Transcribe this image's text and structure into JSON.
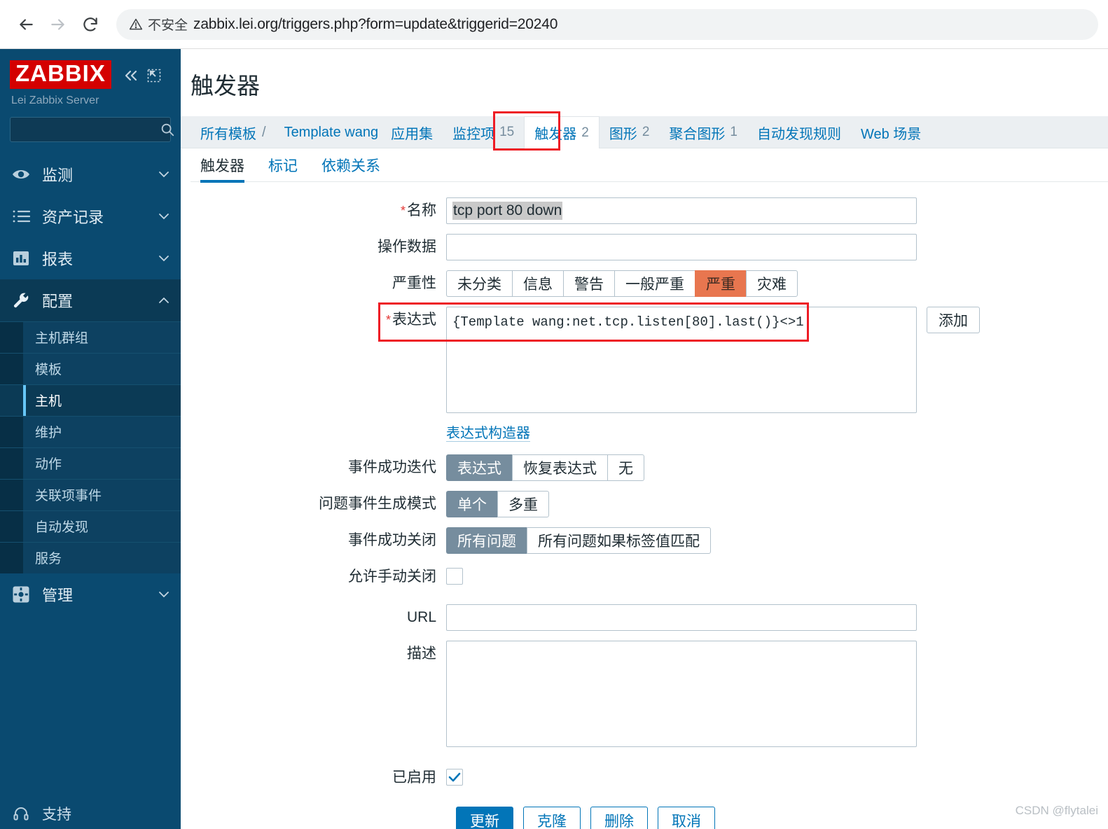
{
  "browser": {
    "back_icon": "back-arrow-icon",
    "forward_icon": "forward-arrow-icon",
    "reload_icon": "reload-icon",
    "security_label": "不安全",
    "security_icon": "warning-triangle-icon",
    "url": "zabbix.lei.org/triggers.php?form=update&triggerid=20240"
  },
  "sidebar": {
    "logo": "ZABBIX",
    "collapse_icon": "double-chevron-left-icon",
    "compact_icon": "compact-view-icon",
    "server_name": "Lei Zabbix Server",
    "search_placeholder": "",
    "search_value": "",
    "search_icon": "search-icon",
    "nav": [
      {
        "label": "监测",
        "icon": "eye-icon",
        "arrow": "chevron-down-icon",
        "active": false
      },
      {
        "label": "资产记录",
        "icon": "list-icon",
        "arrow": "chevron-down-icon",
        "active": false
      },
      {
        "label": "报表",
        "icon": "bar-chart-icon",
        "arrow": "chevron-down-icon",
        "active": false
      },
      {
        "label": "配置",
        "icon": "wrench-icon",
        "arrow": "chevron-up-icon",
        "active": true
      }
    ],
    "subnav": [
      {
        "label": "主机群组",
        "selected": false
      },
      {
        "label": "模板",
        "selected": false
      },
      {
        "label": "主机",
        "selected": true
      },
      {
        "label": "维护",
        "selected": false
      },
      {
        "label": "动作",
        "selected": false
      },
      {
        "label": "关联项事件",
        "selected": false
      },
      {
        "label": "自动发现",
        "selected": false
      },
      {
        "label": "服务",
        "selected": false
      }
    ],
    "admin": {
      "label": "管理",
      "icon": "gear-icon",
      "arrow": "chevron-down-icon"
    },
    "support": {
      "label": "支持",
      "icon": "headset-icon"
    }
  },
  "main": {
    "page_title": "触发器",
    "tabs": [
      {
        "label": "所有模板",
        "count": "",
        "kind": "crumb-link",
        "active": false
      },
      {
        "label": "Template wang",
        "count": "",
        "kind": "crumb-link",
        "active": false
      },
      {
        "label": "应用集",
        "count": "",
        "kind": "tab",
        "active": false
      },
      {
        "label": "监控项",
        "count": "15",
        "kind": "tab",
        "active": false
      },
      {
        "label": "触发器",
        "count": "2",
        "kind": "tab",
        "active": true
      },
      {
        "label": "图形",
        "count": "2",
        "kind": "tab",
        "active": false
      },
      {
        "label": "聚合图形",
        "count": "1",
        "kind": "tab",
        "active": false
      },
      {
        "label": "自动发现规则",
        "count": "",
        "kind": "tab",
        "active": false
      },
      {
        "label": "Web 场景",
        "count": "",
        "kind": "tab",
        "active": false
      }
    ],
    "crumb_separator": "/",
    "subtabs": [
      {
        "label": "触发器",
        "active": true
      },
      {
        "label": "标记",
        "active": false
      },
      {
        "label": "依赖关系",
        "active": false
      }
    ]
  },
  "form": {
    "name": {
      "label": "名称",
      "required": true,
      "value": "tcp port 80 down",
      "selected": true
    },
    "opdata": {
      "label": "操作数据",
      "value": "",
      "placeholder": ""
    },
    "severity": {
      "label": "严重性",
      "options": [
        "未分类",
        "信息",
        "警告",
        "一般严重",
        "严重",
        "灾难"
      ],
      "selected": "严重",
      "selected_color": "#e8764f"
    },
    "expression": {
      "label": "表达式",
      "required": true,
      "value": "{Template wang:net.tcp.listen[80].last()}<>1",
      "add_button": "添加",
      "constructor_link": "表达式构造器"
    },
    "ok_event": {
      "label": "事件成功迭代",
      "options": [
        "表达式",
        "恢复表达式",
        "无"
      ],
      "selected": "表达式"
    },
    "problem_event_mode": {
      "label": "问题事件生成模式",
      "options": [
        "单个",
        "多重"
      ],
      "selected": "单个"
    },
    "ok_event_closes": {
      "label": "事件成功关闭",
      "options": [
        "所有问题",
        "所有问题如果标签值匹配"
      ],
      "selected": "所有问题"
    },
    "allow_manual_close": {
      "label": "允许手动关闭",
      "checked": false
    },
    "url": {
      "label": "URL",
      "value": "",
      "placeholder": ""
    },
    "description": {
      "label": "描述",
      "value": "",
      "placeholder": ""
    },
    "enabled": {
      "label": "已启用",
      "checked": true
    },
    "actions": [
      {
        "label": "更新",
        "style": "primary"
      },
      {
        "label": "克隆",
        "style": "ghost"
      },
      {
        "label": "删除",
        "style": "ghost"
      },
      {
        "label": "取消",
        "style": "ghost"
      }
    ]
  },
  "watermark": "CSDN @flytalei",
  "accent": {
    "brand_red": "#d40000",
    "sidebar_blue": "#0a4a70",
    "link_blue": "#0275b8",
    "annotation_red": "#ee1c25",
    "severity_orange": "#e8764f"
  }
}
